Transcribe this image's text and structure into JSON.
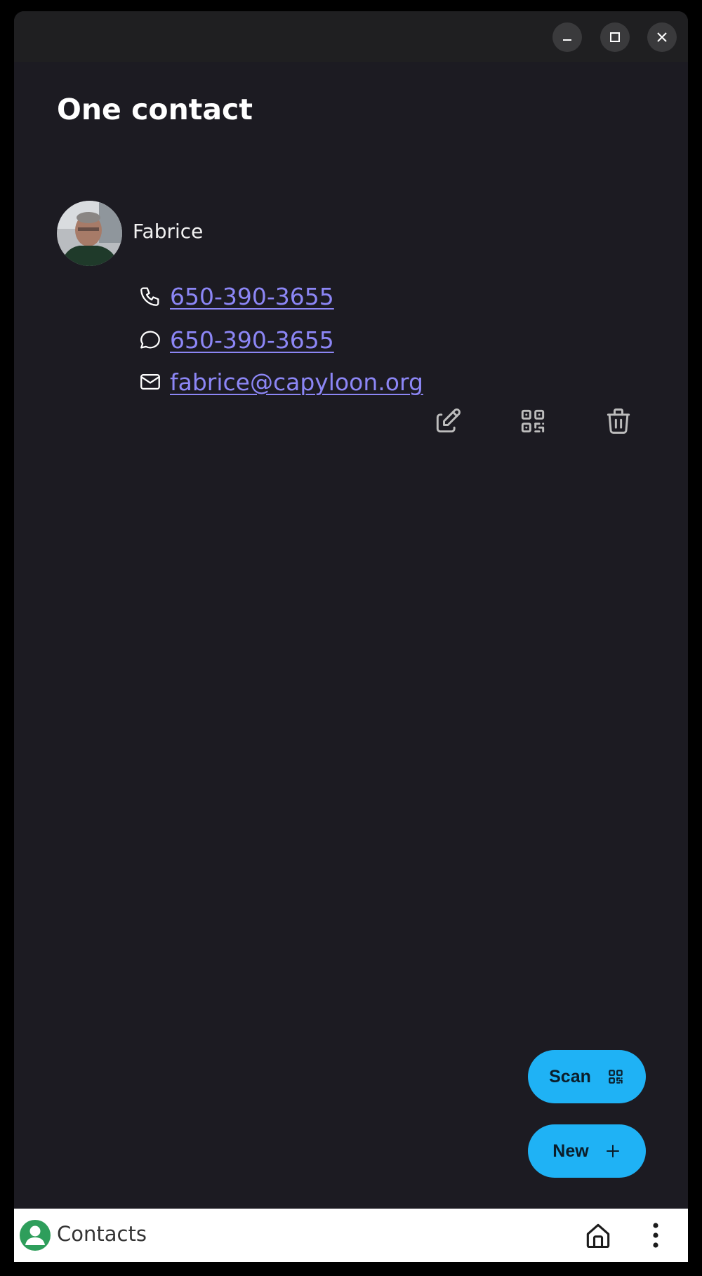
{
  "window": {
    "controls": [
      {
        "name": "minimize-icon"
      },
      {
        "name": "maximize-icon"
      },
      {
        "name": "close-icon"
      }
    ]
  },
  "page": {
    "title": "One contact"
  },
  "contact": {
    "name": "Fabrice",
    "avatar": "contact-photo",
    "phone": "650-390-3655",
    "message": "650-390-3655",
    "email": "fabrice@capyloon.org",
    "icons": {
      "phone": "phone-icon",
      "message": "message-icon",
      "email": "mail-icon"
    },
    "actions": [
      {
        "name": "edit-icon"
      },
      {
        "name": "qr-code-icon"
      },
      {
        "name": "trash-icon"
      }
    ]
  },
  "fabs": {
    "scan_label": "Scan",
    "scan_icon": "qr-code-icon",
    "new_label": "New",
    "new_icon": "plus-icon"
  },
  "bottombar": {
    "app_label": "Contacts",
    "app_icon": "contacts-app-icon",
    "home_icon": "home-icon",
    "menu_icon": "more-vertical-icon"
  },
  "colors": {
    "background": "#1c1b22",
    "link": "#8c86f5",
    "fab": "#1fb2f5",
    "app_icon_green": "#2e9e5b"
  }
}
